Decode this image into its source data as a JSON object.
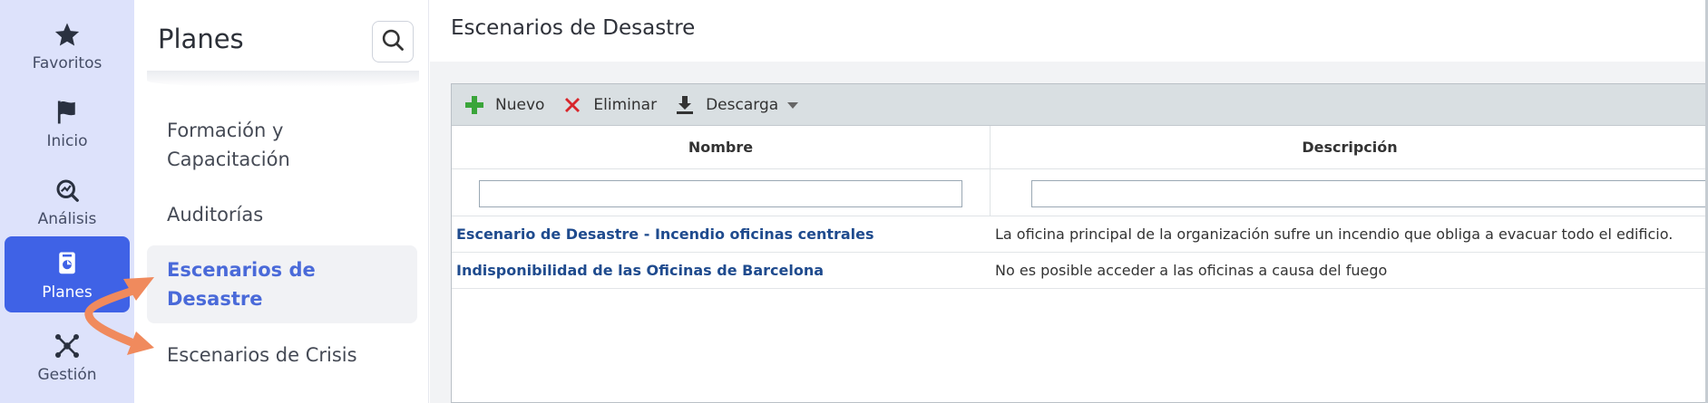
{
  "rail": {
    "items": [
      {
        "label": "Favoritos",
        "icon": "star-icon"
      },
      {
        "label": "Inicio",
        "icon": "flag-icon"
      },
      {
        "label": "Análisis",
        "icon": "analysis-icon"
      },
      {
        "label": "Planes",
        "icon": "plans-icon",
        "active": true
      },
      {
        "label": "Gestión",
        "icon": "network-icon"
      }
    ],
    "active_color": "#3f62e6",
    "background": "#dde2fb"
  },
  "subnav": {
    "title": "Planes",
    "items": [
      {
        "label": "Formación y Capacitación"
      },
      {
        "label": "Auditorías"
      },
      {
        "label": "Escenarios de Desastre",
        "active": true
      },
      {
        "label": "Escenarios de Crisis"
      }
    ]
  },
  "main": {
    "title": "Escenarios de Desastre",
    "toolbar": {
      "new_label": "Nuevo",
      "delete_label": "Eliminar",
      "download_label": "Descarga"
    },
    "table": {
      "columns": [
        "Nombre",
        "Descripción"
      ],
      "filters": [
        "",
        ""
      ],
      "rows": [
        {
          "name": "Escenario de Desastre - Incendio oficinas centrales",
          "description": "La oficina principal de la organización sufre un incendio que obliga a evacuar todo el edificio."
        },
        {
          "name": "Indisponibilidad de las Oficinas de Barcelona",
          "description": "No es posible acceder a las oficinas a causa del fuego"
        }
      ]
    }
  },
  "annotation_color": "#f08a5d"
}
